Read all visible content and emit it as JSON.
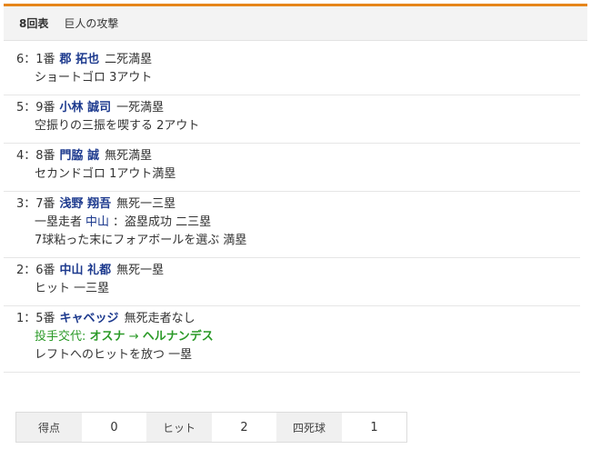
{
  "header": {
    "inning": "8回表",
    "title": "巨人の攻撃"
  },
  "plays": [
    {
      "num": "6：1番",
      "player": "郡 拓也",
      "state": "二死満塁",
      "result": "ショートゴロ 3アウト"
    },
    {
      "num": "5：9番",
      "player": "小林 誠司",
      "state": "一死満塁",
      "result": "空振りの三振を喫する 2アウト"
    },
    {
      "num": "4：8番",
      "player": "門脇 誠",
      "state": "無死満塁",
      "result": "セカンドゴロ 1アウト満塁"
    },
    {
      "num": "3：7番",
      "player": "浅野 翔吾",
      "state": "無死一三塁",
      "runner_pre": "一塁走者",
      "runner": "中山",
      "runner_post": "：盗塁成功 二三塁",
      "result": "7球粘った末にフォアボールを選ぶ 満塁"
    },
    {
      "num": "2：6番",
      "player": "中山 礼都",
      "state": "無死一塁",
      "result": "ヒット 一三塁"
    },
    {
      "num": "1：5番",
      "player": "キャベッジ",
      "state": "無死走者なし",
      "pitcher_label": "投手交代:",
      "pitcher_from": "オスナ",
      "arrow": "→",
      "pitcher_to": "ヘルナンデス",
      "result": "レフトへのヒットを放つ 一塁"
    }
  ],
  "stats": {
    "runs_label": "得点",
    "runs": "0",
    "hits_label": "ヒット",
    "hits": "2",
    "walks_label": "四死球",
    "walks": "1"
  }
}
